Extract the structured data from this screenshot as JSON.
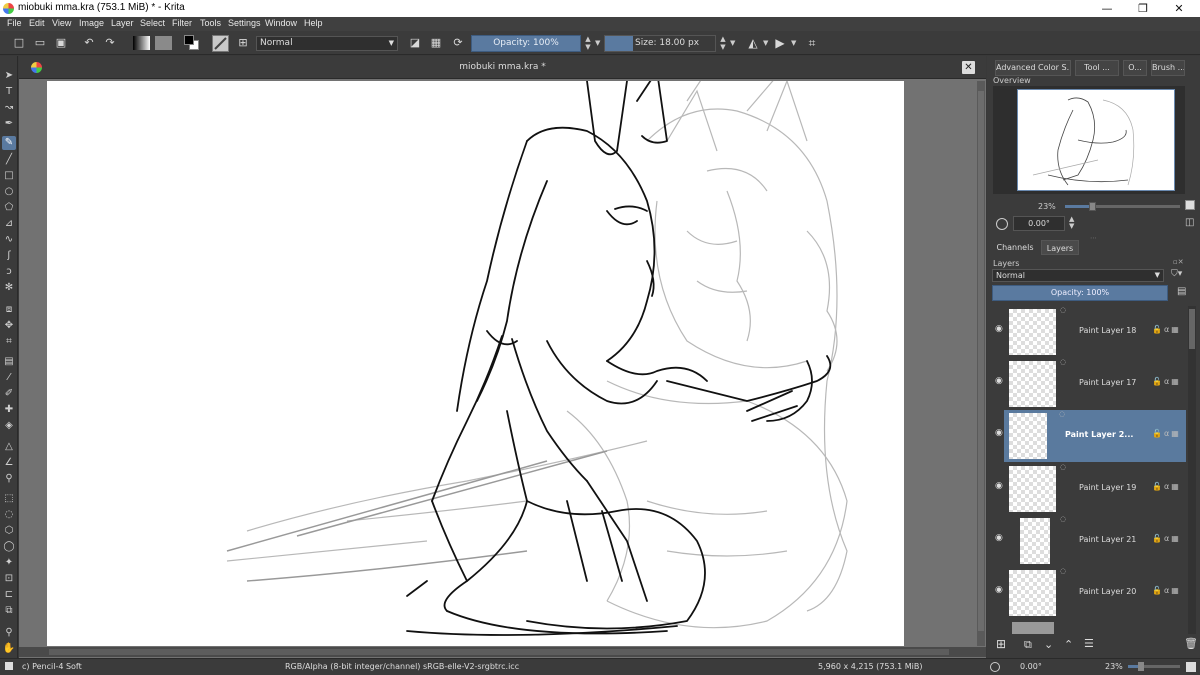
{
  "window": {
    "title": "miobuki mma.kra (753.1 MiB)  * - Krita",
    "min_glyph": "—",
    "max_glyph": "❐",
    "close_glyph": "✕"
  },
  "menu": [
    "File",
    "Edit",
    "View",
    "Image",
    "Layer",
    "Select",
    "Filter",
    "Tools",
    "Settings",
    "Window",
    "Help"
  ],
  "toolbar": {
    "blend_mode": "Normal",
    "opacity_label": "Opacity: 100%",
    "size_label": "Size: 18.00 px",
    "icons": [
      "new-document-icon",
      "open-document-icon",
      "save-icon",
      "undo-icon",
      "redo-icon",
      "gradient-icon",
      "pattern-icon",
      "fg-bg-color-icon",
      "brush-preset-icon",
      "brush-settings-icon",
      "eraser-icon",
      "alpha-lock-icon",
      "reload-preset-icon",
      "mirror-horizontal-icon",
      "mirror-vertical-icon",
      "wrap-around-icon"
    ]
  },
  "document": {
    "tab_title": "miobuki mma.kra *",
    "close_glyph": "✕"
  },
  "tools": [
    "pointer",
    "text",
    "assistant",
    "calligraphy",
    "freehand-brush",
    "line",
    "rectangle",
    "ellipse",
    "polygon",
    "polyline",
    "bezier",
    "freehand-path",
    "dynamic-brush",
    "multibrush",
    "transform",
    "move",
    "crop",
    "gradient",
    "color-picker",
    "colorize-mask",
    "smart-patch",
    "fill",
    "assistant-tool",
    "measure",
    "reference",
    "rect-select",
    "ellipse-select",
    "polygon-select",
    "freehand-select",
    "contiguous-select",
    "similar-select",
    "bezier-select",
    "magnetic-select",
    "zoom",
    "pan"
  ],
  "docker": {
    "tabs": [
      "Advanced Color S...",
      "Tool ...",
      "O...",
      "Brush ..."
    ],
    "overview_label": "Overview",
    "zoom_value": "23%",
    "rotation_value": "0.00°",
    "panel_tabs": [
      "Channels",
      "Layers"
    ],
    "layers_label": "Layers",
    "layer_blend": "Normal",
    "layer_opacity": "Opacity:  100%",
    "layers": [
      {
        "name": "Paint Layer 18",
        "selected": false
      },
      {
        "name": "Paint Layer 17",
        "selected": false
      },
      {
        "name": "Paint Layer 2...",
        "selected": true
      },
      {
        "name": "Paint Layer 19",
        "selected": false
      },
      {
        "name": "Paint Layer 21",
        "selected": false
      },
      {
        "name": "Paint Layer 20",
        "selected": false
      }
    ]
  },
  "status": {
    "brush": "c) Pencil-4 Soft",
    "color_space": "RGB/Alpha (8-bit integer/channel)  sRGB-elle-V2-srgbtrc.icc",
    "dimensions": "5,960 x 4,215 (753.1 MiB)",
    "rotation": "0.00°",
    "zoom": "23%"
  },
  "colors": {
    "accent": "#5a7aa0",
    "panel": "#3b3b3b",
    "canvas_bg": "#727272"
  }
}
